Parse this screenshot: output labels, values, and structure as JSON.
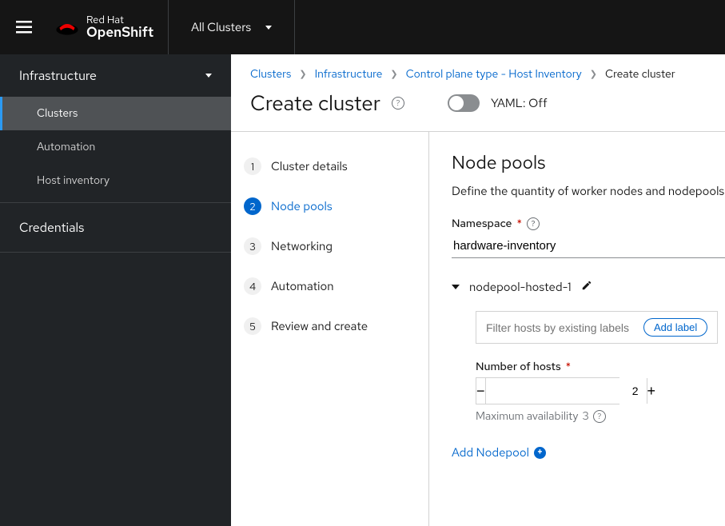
{
  "brand": {
    "line1": "Red Hat",
    "line2": "OpenShift"
  },
  "cluster_selector": "All Clusters",
  "sidebar": {
    "section": "Infrastructure",
    "items": [
      "Clusters",
      "Automation",
      "Host inventory"
    ],
    "credentials": "Credentials"
  },
  "breadcrumbs": {
    "items": [
      "Clusters",
      "Infrastructure",
      "Control plane type - Host Inventory"
    ],
    "current": "Create cluster"
  },
  "page_title": "Create cluster",
  "yaml_toggle": "YAML: Off",
  "wizard": {
    "steps": [
      "Cluster details",
      "Node pools",
      "Networking",
      "Automation",
      "Review and create"
    ],
    "active_index": 1
  },
  "form": {
    "title": "Node pools",
    "description": "Define the quantity of worker nodes and nodepools to c",
    "namespace_label": "Namespace",
    "namespace_value": "hardware-inventory",
    "nodepool_name": "nodepool-hosted-1",
    "filter_placeholder": "Filter hosts by existing labels",
    "add_label": "Add label",
    "hosts_label": "Number of hosts",
    "hosts_value": "2",
    "max_availability_label": "Maximum availability",
    "max_availability_value": "3",
    "add_nodepool": "Add Nodepool"
  }
}
